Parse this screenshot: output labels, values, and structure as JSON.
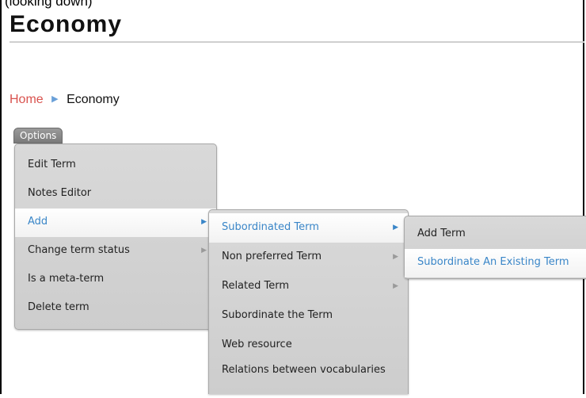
{
  "page": {
    "top_clip_text": "(looking down)",
    "title": "Economy"
  },
  "breadcrumb": {
    "home": "Home",
    "current": "Economy"
  },
  "options_label": "Options",
  "menu_main": [
    {
      "label": "Edit Term",
      "has_submenu": false
    },
    {
      "label": "Notes Editor",
      "has_submenu": false
    },
    {
      "label": "Add",
      "has_submenu": true
    },
    {
      "label": "Change term status",
      "has_submenu": true
    },
    {
      "label": "Is a meta-term",
      "has_submenu": false
    },
    {
      "label": "Delete term",
      "has_submenu": false
    }
  ],
  "menu_add": [
    {
      "label": "Subordinated Term",
      "has_submenu": true
    },
    {
      "label": "Non preferred Term",
      "has_submenu": true
    },
    {
      "label": "Related Term",
      "has_submenu": true
    },
    {
      "label": "Subordinate the Term",
      "has_submenu": false
    },
    {
      "label": "Web resource",
      "has_submenu": false
    },
    {
      "label": "Relations between vocabularies",
      "has_submenu": false
    }
  ],
  "menu_subordinated": [
    {
      "label": "Add Term"
    },
    {
      "label": "Subordinate An Existing Term"
    }
  ],
  "colors": {
    "link": "#d9534f",
    "highlight_text": "#3a86c8",
    "menu_bg": "#d4d4d4"
  },
  "icons": {
    "breadcrumb_separator": "triangle-right-icon",
    "submenu_arrow": "chevron-right-icon"
  }
}
